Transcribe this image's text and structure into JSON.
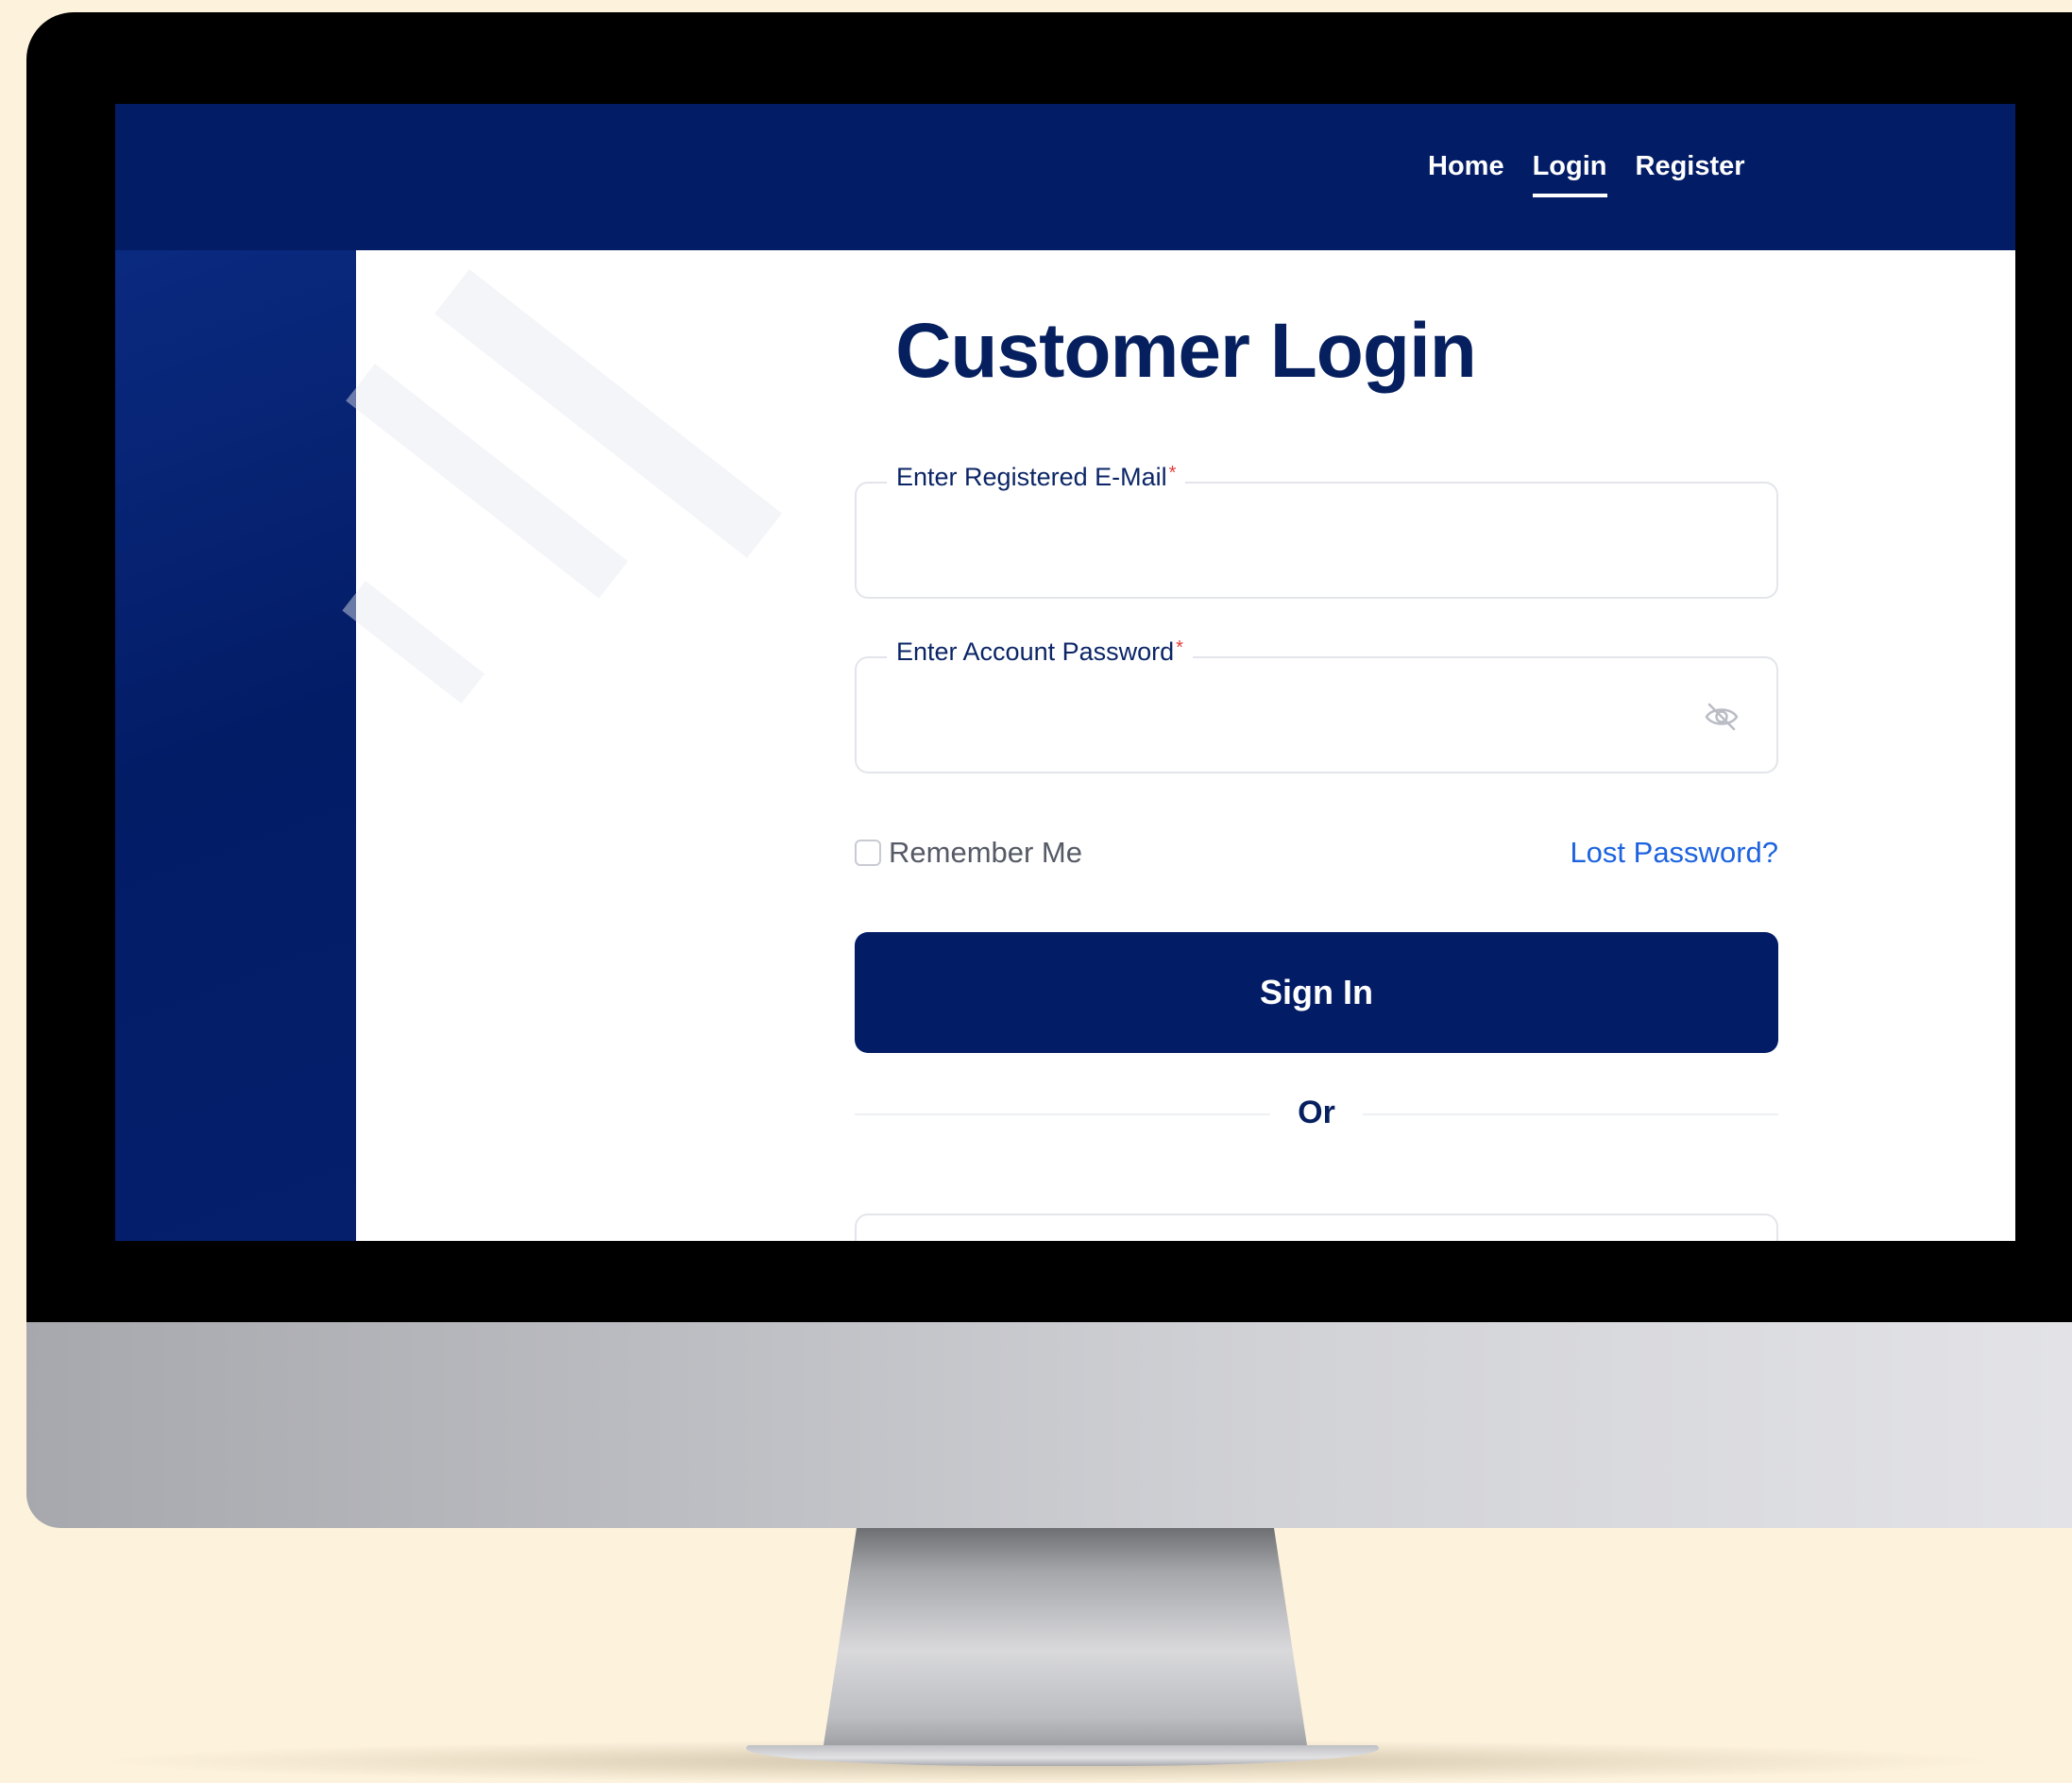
{
  "nav": {
    "items": [
      {
        "label": "Home",
        "active": false
      },
      {
        "label": "Login",
        "active": true
      },
      {
        "label": "Register",
        "active": false
      }
    ]
  },
  "login": {
    "title": "Customer Login",
    "email_label": "Enter Registered E-Mail",
    "email_value": "",
    "password_label": "Enter Account Password",
    "password_value": "",
    "required_mark": "*",
    "password_visibility_icon": "eye-off-icon",
    "remember_label": "Remember Me",
    "remember_checked": false,
    "lost_password": "Lost Password?",
    "signin_label": "Sign In",
    "divider": "Or"
  },
  "colors": {
    "brand_navy": "#031c66",
    "title_navy": "#06205f",
    "link_blue": "#1d63e0",
    "required_red": "#e23c3c",
    "page_bg": "#fdf2dc"
  }
}
